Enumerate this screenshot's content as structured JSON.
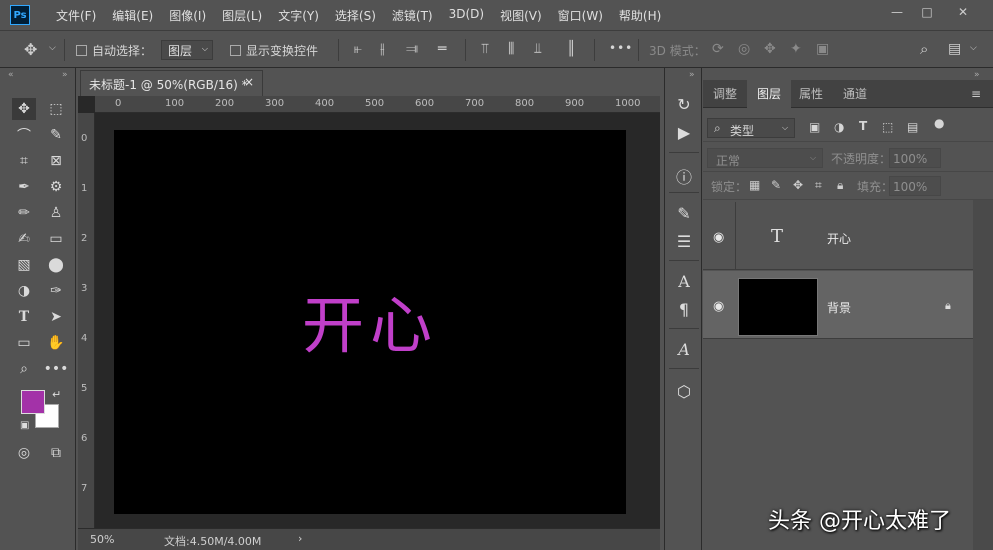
{
  "app": {
    "logo_text": "Ps"
  },
  "menubar": {
    "items": [
      "文件(F)",
      "编辑(E)",
      "图像(I)",
      "图层(L)",
      "文字(Y)",
      "选择(S)",
      "滤镜(T)",
      "3D(D)",
      "视图(V)",
      "窗口(W)",
      "帮助(H)"
    ],
    "window_controls": [
      "minimize",
      "maximize",
      "close"
    ]
  },
  "options": {
    "auto_select_label": "自动选择：",
    "auto_select_target": "图层",
    "show_transform_label": "显示变换控件",
    "mode_3d_label": "3D 模式：",
    "more_label": "•••"
  },
  "document": {
    "tab_title": "未标题-1 @ 50%(RGB/16) *",
    "close_glyph": "×",
    "ruler_top_labels": [
      "0",
      "100",
      "200",
      "300",
      "400",
      "500",
      "600",
      "700",
      "800",
      "900",
      "1000"
    ],
    "ruler_left_labels": [
      "0",
      "1",
      "2",
      "3",
      "4",
      "5",
      "6",
      "7"
    ],
    "canvas_text": "开心",
    "canvas_text_color": "#c03fc9",
    "canvas_background": "#000000"
  },
  "status": {
    "zoom": "50%",
    "doc_info": "文档:4.50M/4.00M",
    "arrow": "›"
  },
  "panel": {
    "tabs": [
      "调整",
      "图层",
      "属性",
      "通道"
    ],
    "active_tab": "图层",
    "filter_kind": "类型",
    "blend_mode": "正常",
    "opacity_label": "不透明度：",
    "opacity_value": "100%",
    "lock_label": "锁定：",
    "fill_label": "填充：",
    "fill_value": "100%",
    "layers": [
      {
        "name": "开心",
        "type": "text",
        "thumb_glyph": "T"
      },
      {
        "name": "背景",
        "type": "background",
        "locked": true
      }
    ]
  },
  "colors": {
    "foreground": "#a332a8",
    "background": "#ffffff",
    "ui_bg": "#535353"
  },
  "watermark": "头条 @开心太难了"
}
